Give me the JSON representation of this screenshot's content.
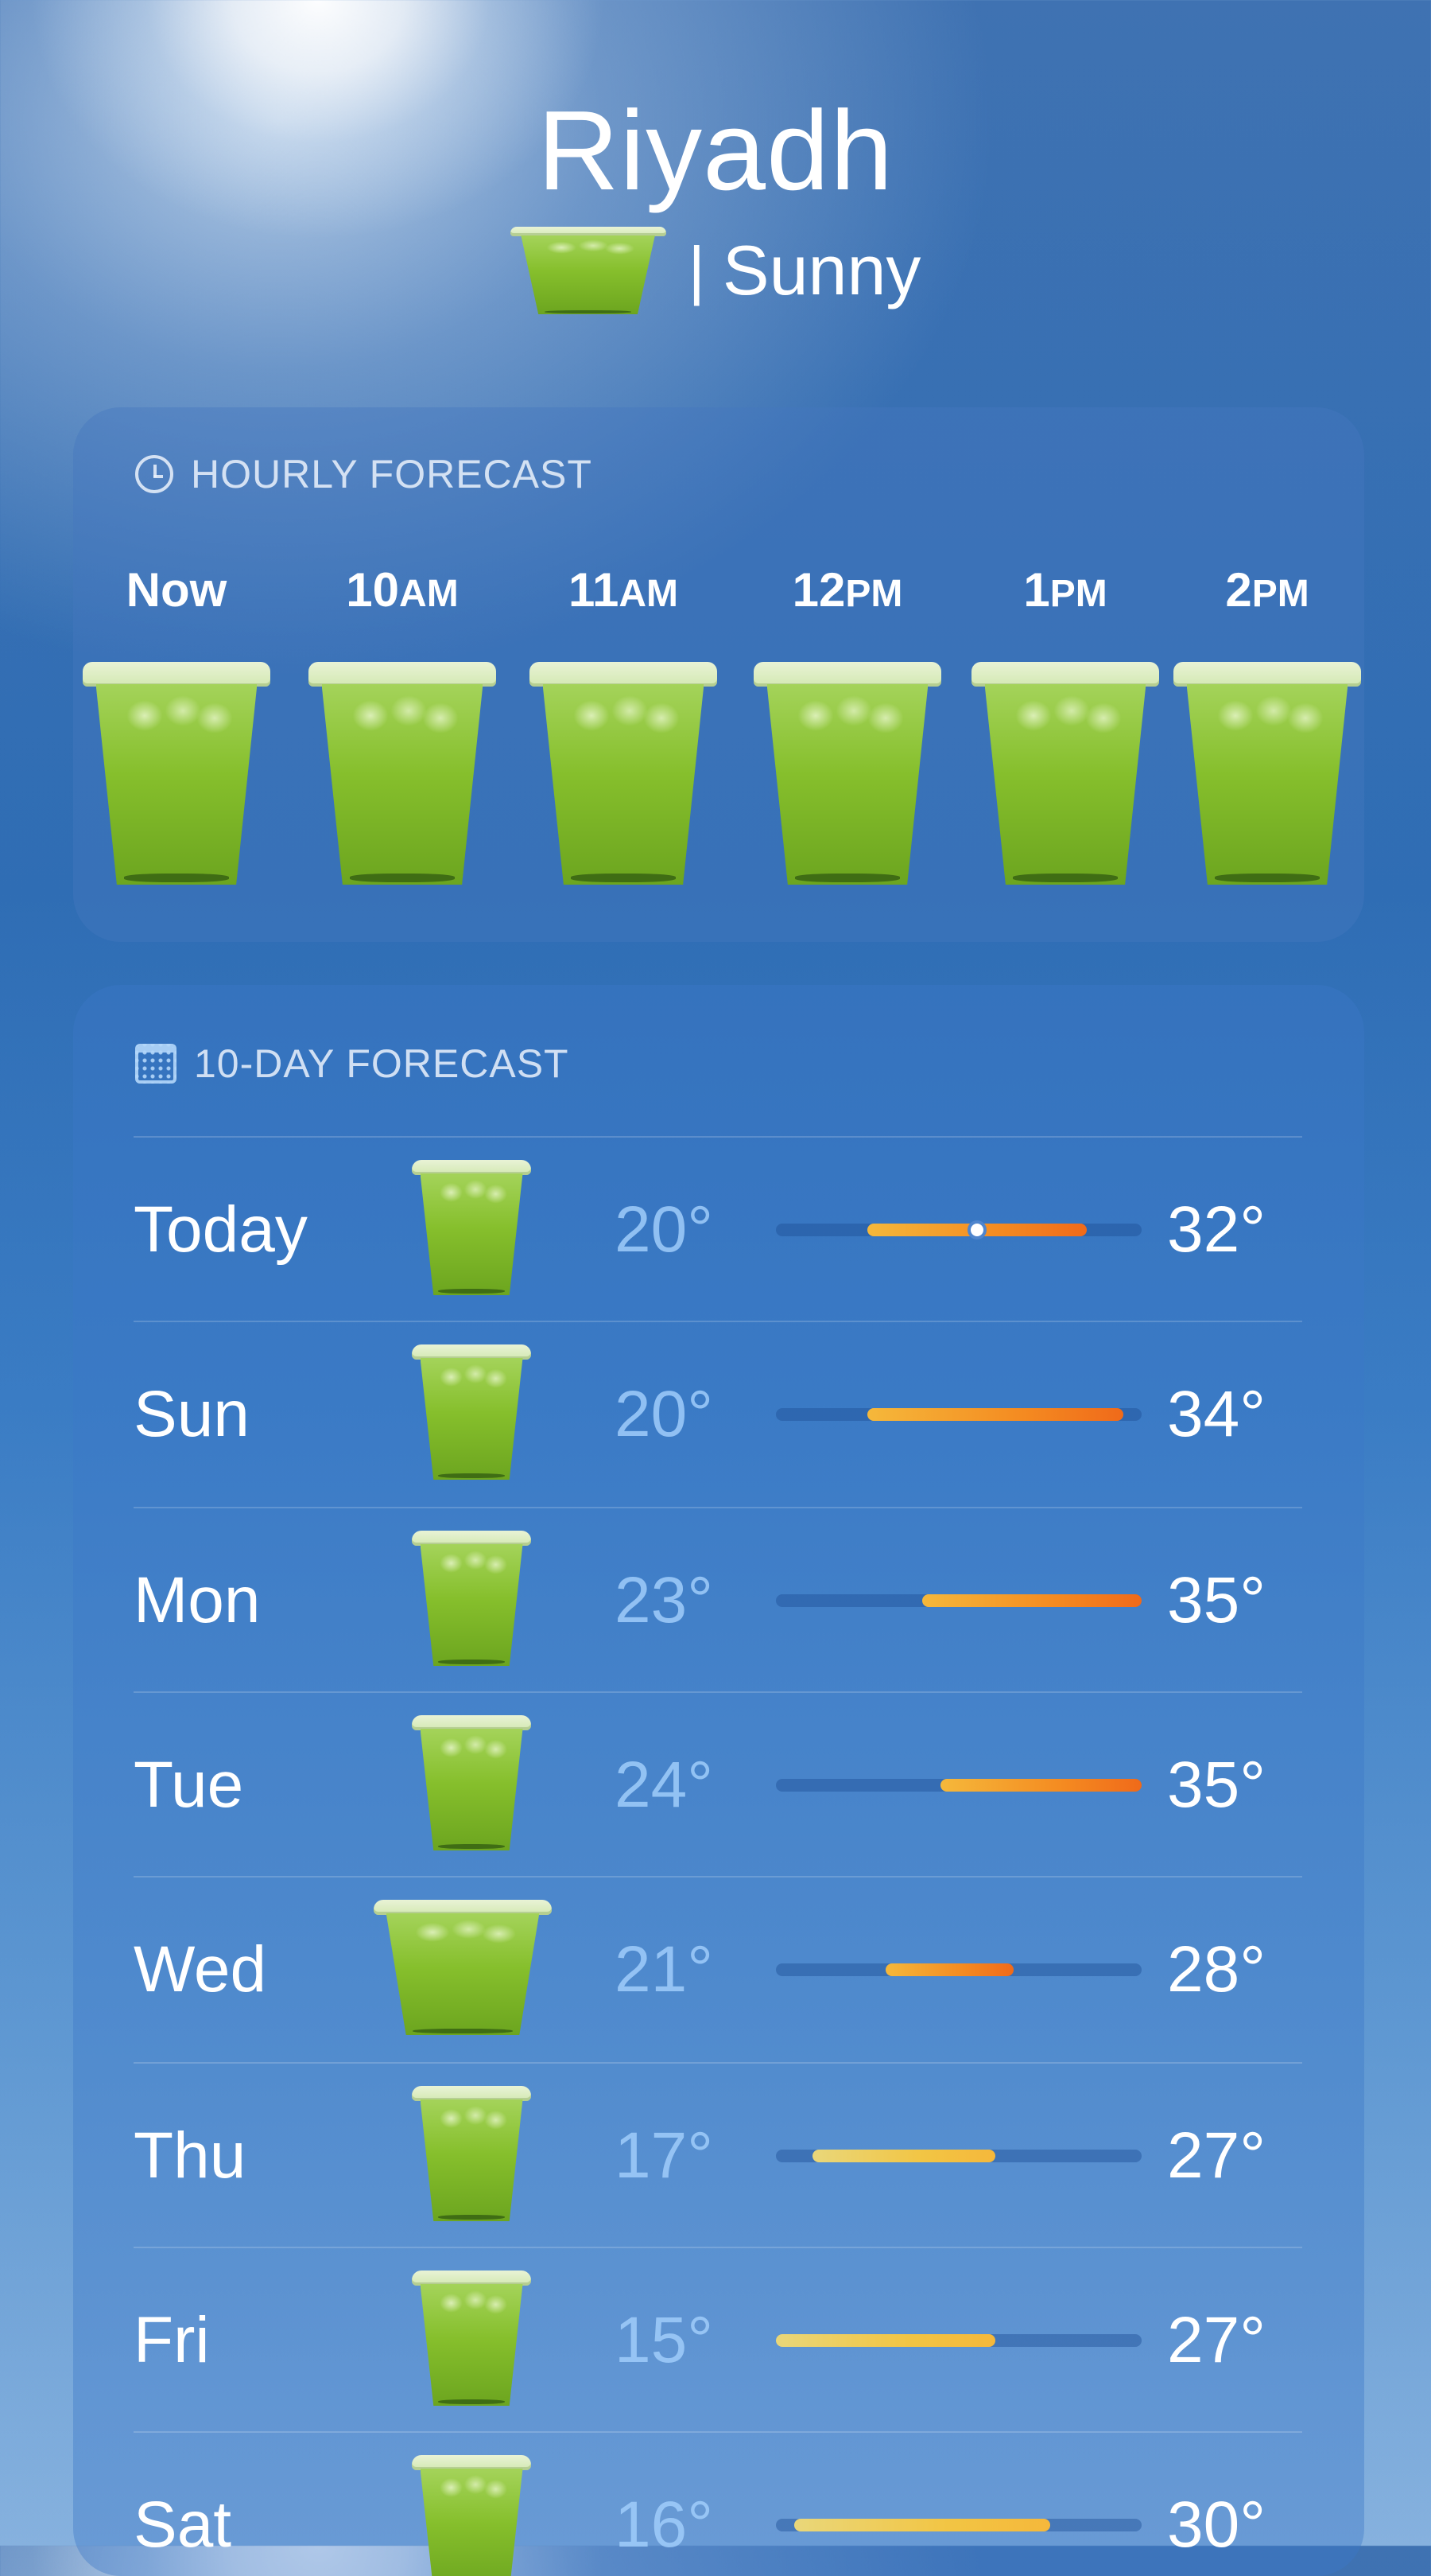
{
  "location": {
    "city": "Riyadh",
    "condition": "Sunny",
    "separator": "|",
    "condition_icon": "matcha-cup-icon"
  },
  "hourly": {
    "title": "HOURLY FORECAST",
    "icon": "clock-icon",
    "hours": [
      {
        "main": "Now",
        "ampm": ""
      },
      {
        "main": "10",
        "ampm": "AM"
      },
      {
        "main": "11",
        "ampm": "AM"
      },
      {
        "main": "12",
        "ampm": "PM"
      },
      {
        "main": "1",
        "ampm": "PM"
      },
      {
        "main": "2",
        "ampm": "PM"
      }
    ]
  },
  "daily": {
    "title": "10-DAY FORECAST",
    "icon": "calendar-icon",
    "range_scale": [
      15,
      35
    ],
    "days": [
      {
        "day": "Today",
        "low": "20°",
        "high": "32°",
        "low_val": 20,
        "high_val": 32,
        "current_val": 26
      },
      {
        "day": "Sun",
        "low": "20°",
        "high": "34°",
        "low_val": 20,
        "high_val": 34
      },
      {
        "day": "Mon",
        "low": "23°",
        "high": "35°",
        "low_val": 23,
        "high_val": 35
      },
      {
        "day": "Tue",
        "low": "24°",
        "high": "35°",
        "low_val": 24,
        "high_val": 35
      },
      {
        "day": "Wed",
        "low": "21°",
        "high": "28°",
        "low_val": 21,
        "high_val": 28
      },
      {
        "day": "Thu",
        "low": "17°",
        "high": "27°",
        "low_val": 17,
        "high_val": 27
      },
      {
        "day": "Fri",
        "low": "15°",
        "high": "27°",
        "low_val": 15,
        "high_val": 27
      },
      {
        "day": "Sat",
        "low": "16°",
        "high": "30°",
        "low_val": 16,
        "high_val": 30
      }
    ]
  }
}
